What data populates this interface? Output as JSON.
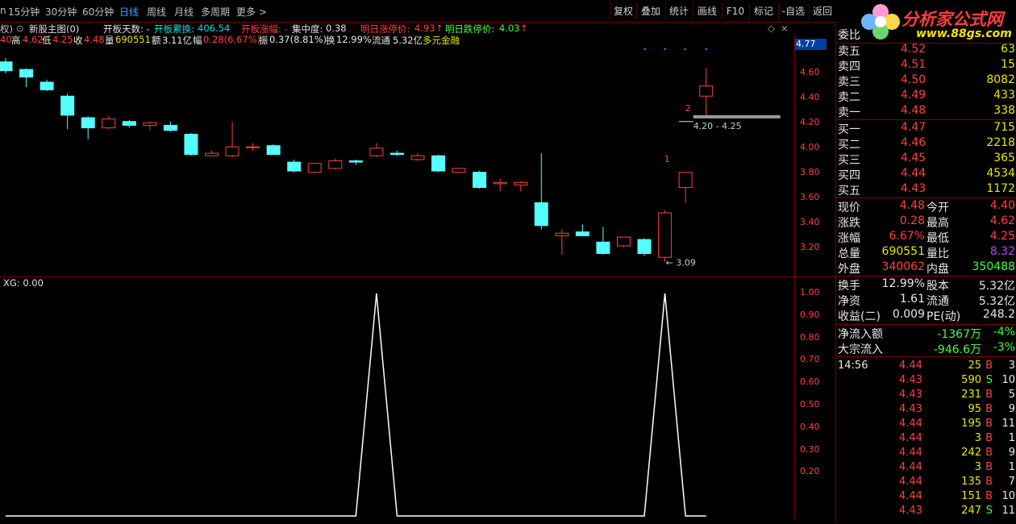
{
  "colors": {
    "up": "#ff4040",
    "down": "#54ffff",
    "line": "#ffffff",
    "grid": "#800000"
  },
  "topbar": {
    "periods": [
      "n",
      "15分钟",
      "30分钟",
      "60分钟",
      "日线",
      "周线",
      "月线",
      "多周期",
      "更多 >"
    ],
    "active_period": "日线",
    "buttons": [
      "复权",
      "叠加",
      "统计",
      "画线",
      "F10",
      "标记",
      "-自选",
      "返回"
    ]
  },
  "logo": {
    "title": "分析家公式网",
    "url": "www.88gs.com"
  },
  "header": {
    "left_mark": "权)",
    "main_name": "新股主图(0)",
    "kaiban_days": "开板天数: -",
    "kaiban_turnover_label": "开板累换:",
    "kaiban_turnover": "406.54",
    "kaiban_amp_label": "开板涨幅: -",
    "concentration_label": "集中度:",
    "concentration": "0.38",
    "limit_up_label": "明日涨停价:",
    "limit_up": "4.93",
    "limit_down_label": "明日跌停价:",
    "limit_down": "4.03"
  },
  "quote_line": {
    "open": "40",
    "high_label": "高",
    "high": "4.62",
    "low_label": "低",
    "low": "4.25",
    "close_label": "收",
    "close": "4.48",
    "vol_label": "量",
    "vol": "690551",
    "amt_label": "额",
    "amt": "3.11亿",
    "pct_label": "幅",
    "pct": "0.28(6.67%)",
    "amp_label": "振",
    "amp": "0.37(8.81%)",
    "turn_label": "换",
    "turn": "12.99%",
    "float_label": "流通",
    "float": "5.32亿",
    "sector": "多元金融"
  },
  "price_axis": {
    "top": "4.77",
    "ticks": [
      "4.60",
      "4.40",
      "4.20",
      "4.00",
      "3.80",
      "3.60",
      "3.40",
      "3.20"
    ]
  },
  "annotations": {
    "range": "4.20 - 4.25",
    "low_mark": "3.09",
    "num1": "1",
    "num2": "2"
  },
  "indicator": {
    "label": "XG: 0.00",
    "ticks": [
      "1.00",
      "0.90",
      "0.80",
      "0.70",
      "0.60",
      "0.50",
      "0.40",
      "0.30",
      "0.20"
    ]
  },
  "chart_data": {
    "type": "candlestick",
    "candles": [
      {
        "o": 4.67,
        "h": 4.7,
        "l": 4.58,
        "c": 4.6
      },
      {
        "o": 4.61,
        "h": 4.62,
        "l": 4.47,
        "c": 4.55
      },
      {
        "o": 4.51,
        "h": 4.53,
        "l": 4.44,
        "c": 4.45
      },
      {
        "o": 4.4,
        "h": 4.42,
        "l": 4.14,
        "c": 4.25
      },
      {
        "o": 4.23,
        "h": 4.24,
        "l": 4.06,
        "c": 4.15
      },
      {
        "o": 4.15,
        "h": 4.24,
        "l": 4.14,
        "c": 4.22
      },
      {
        "o": 4.2,
        "h": 4.21,
        "l": 4.15,
        "c": 4.17
      },
      {
        "o": 4.17,
        "h": 4.2,
        "l": 4.13,
        "c": 4.19
      },
      {
        "o": 4.17,
        "h": 4.2,
        "l": 4.12,
        "c": 4.13
      },
      {
        "o": 4.1,
        "h": 4.11,
        "l": 3.93,
        "c": 3.94
      },
      {
        "o": 3.93,
        "h": 3.97,
        "l": 3.93,
        "c": 3.95
      },
      {
        "o": 3.93,
        "h": 4.2,
        "l": 3.92,
        "c": 4.0
      },
      {
        "o": 4.0,
        "h": 4.03,
        "l": 3.97,
        "c": 4.0
      },
      {
        "o": 4.01,
        "h": 4.02,
        "l": 3.94,
        "c": 3.94
      },
      {
        "o": 3.88,
        "h": 3.9,
        "l": 3.8,
        "c": 3.81
      },
      {
        "o": 3.8,
        "h": 3.87,
        "l": 3.79,
        "c": 3.87
      },
      {
        "o": 3.83,
        "h": 3.91,
        "l": 3.82,
        "c": 3.89
      },
      {
        "o": 3.89,
        "h": 3.9,
        "l": 3.86,
        "c": 3.88
      },
      {
        "o": 3.93,
        "h": 4.03,
        "l": 3.92,
        "c": 3.99
      },
      {
        "o": 3.95,
        "h": 3.97,
        "l": 3.93,
        "c": 3.94
      },
      {
        "o": 3.9,
        "h": 3.95,
        "l": 3.89,
        "c": 3.93
      },
      {
        "o": 3.93,
        "h": 3.94,
        "l": 3.8,
        "c": 3.81
      },
      {
        "o": 3.8,
        "h": 3.83,
        "l": 3.79,
        "c": 3.83
      },
      {
        "o": 3.8,
        "h": 3.81,
        "l": 3.67,
        "c": 3.68
      },
      {
        "o": 3.71,
        "h": 3.75,
        "l": 3.65,
        "c": 3.72
      },
      {
        "o": 3.7,
        "h": 3.73,
        "l": 3.65,
        "c": 3.72
      },
      {
        "o": 3.56,
        "h": 3.95,
        "l": 3.35,
        "c": 3.38
      },
      {
        "o": 3.3,
        "h": 3.35,
        "l": 3.15,
        "c": 3.32
      },
      {
        "o": 3.33,
        "h": 3.39,
        "l": 3.3,
        "c": 3.3
      },
      {
        "o": 3.25,
        "h": 3.37,
        "l": 3.15,
        "c": 3.16
      },
      {
        "o": 3.22,
        "h": 3.29,
        "l": 3.21,
        "c": 3.29
      },
      {
        "o": 3.27,
        "h": 3.28,
        "l": 3.14,
        "c": 3.16
      },
      {
        "o": 3.13,
        "h": 3.5,
        "l": 3.09,
        "c": 3.48
      },
      {
        "o": 3.68,
        "h": 3.8,
        "l": 3.56,
        "c": 3.8
      },
      {
        "o": 4.4,
        "h": 4.62,
        "l": 4.25,
        "c": 4.48
      }
    ],
    "xg": [
      0,
      0,
      0,
      0,
      0,
      0,
      0,
      0,
      0,
      0,
      0,
      0,
      0,
      0,
      0,
      0,
      0,
      0,
      1,
      0,
      0,
      0,
      0,
      0,
      0,
      0,
      0,
      0,
      0,
      0,
      0,
      0,
      1,
      0,
      0
    ],
    "ylim": [
      3.05,
      4.77
    ]
  },
  "order_book": {
    "wei_label": "委比",
    "asks": [
      {
        "label": "卖五",
        "price": "4.52",
        "vol": "63"
      },
      {
        "label": "卖四",
        "price": "4.51",
        "vol": "15"
      },
      {
        "label": "卖三",
        "price": "4.50",
        "vol": "8082"
      },
      {
        "label": "卖二",
        "price": "4.49",
        "vol": "433"
      },
      {
        "label": "卖一",
        "price": "4.48",
        "vol": "338"
      }
    ],
    "bids": [
      {
        "label": "买一",
        "price": "4.47",
        "vol": "715"
      },
      {
        "label": "买二",
        "price": "4.46",
        "vol": "2218"
      },
      {
        "label": "买三",
        "price": "4.45",
        "vol": "365"
      },
      {
        "label": "买四",
        "price": "4.44",
        "vol": "4534"
      },
      {
        "label": "买五",
        "price": "4.43",
        "vol": "1172"
      }
    ]
  },
  "stats": [
    {
      "l1": "现价",
      "v1": "4.48",
      "c1": "red",
      "l2": "今开",
      "v2": "4.40",
      "c2": "red"
    },
    {
      "l1": "涨跌",
      "v1": "0.28",
      "c1": "red",
      "l2": "最高",
      "v2": "4.62",
      "c2": "red"
    },
    {
      "l1": "涨幅",
      "v1": "6.67%",
      "c1": "red",
      "l2": "最低",
      "v2": "4.25",
      "c2": "red"
    },
    {
      "l1": "总量",
      "v1": "690551",
      "c1": "yel",
      "l2": "量比",
      "v2": "8.32",
      "c2": "mag"
    },
    {
      "l1": "外盘",
      "v1": "340062",
      "c1": "red",
      "l2": "内盘",
      "v2": "350488",
      "c2": "grn"
    }
  ],
  "fund": [
    {
      "l1": "换手",
      "v1": "12.99%",
      "l2": "股本",
      "v2": "5.32亿"
    },
    {
      "l1": "净资",
      "v1": "1.61",
      "l2": "流通",
      "v2": "5.32亿"
    },
    {
      "l1": "收益(二)",
      "v1": "0.009",
      "l2": "PE(动)",
      "v2": "248.2"
    }
  ],
  "flow": [
    {
      "label": "净流入额",
      "value": "-1367万",
      "pct": "-4%"
    },
    {
      "label": "大宗流入",
      "value": "-946.6万",
      "pct": "-3%"
    }
  ],
  "ticks": [
    {
      "time": "14:56",
      "price": "4.44",
      "vol": "25",
      "bs": "B",
      "n": "3"
    },
    {
      "time": "",
      "price": "4.43",
      "vol": "590",
      "bs": "S",
      "n": "10"
    },
    {
      "time": "",
      "price": "4.43",
      "vol": "231",
      "bs": "B",
      "n": "5"
    },
    {
      "time": "",
      "price": "4.43",
      "vol": "95",
      "bs": "B",
      "n": "9"
    },
    {
      "time": "",
      "price": "4.44",
      "vol": "195",
      "bs": "B",
      "n": "11"
    },
    {
      "time": "",
      "price": "4.44",
      "vol": "3",
      "bs": "B",
      "n": "1"
    },
    {
      "time": "",
      "price": "4.44",
      "vol": "242",
      "bs": "B",
      "n": "9"
    },
    {
      "time": "",
      "price": "4.44",
      "vol": "3",
      "bs": "B",
      "n": "1"
    },
    {
      "time": "",
      "price": "4.44",
      "vol": "135",
      "bs": "B",
      "n": "7"
    },
    {
      "time": "",
      "price": "4.44",
      "vol": "151",
      "bs": "B",
      "n": "10"
    },
    {
      "time": "",
      "price": "4.43",
      "vol": "247",
      "bs": "S",
      "n": "11"
    }
  ]
}
